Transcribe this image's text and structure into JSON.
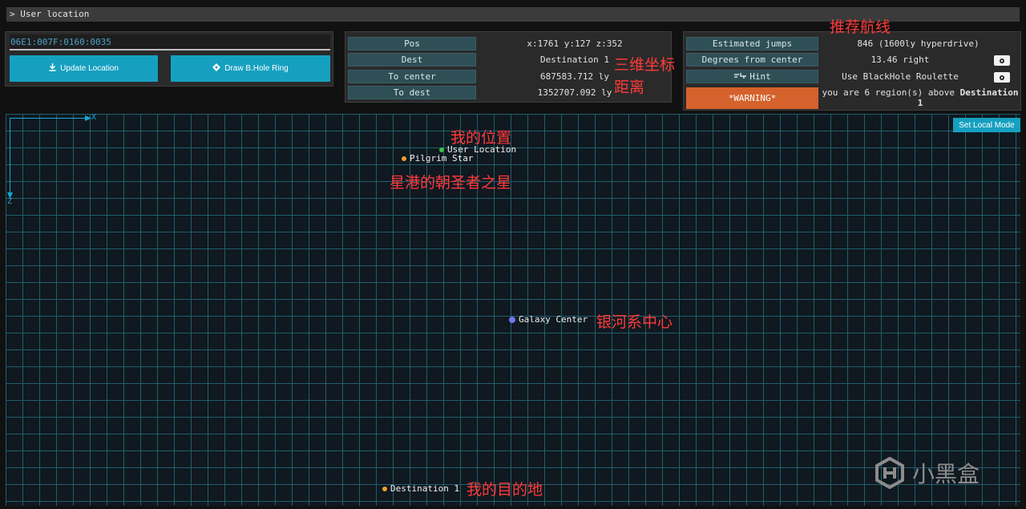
{
  "header": {
    "title": "> User location"
  },
  "location": {
    "coord_value": "06E1:007F:0160:0035",
    "update_button": "Update Location",
    "draw_button": "Draw B.Hole Ring"
  },
  "position_panel": {
    "rows": [
      {
        "label": "Pos",
        "value": "x:1761 y:127 z:352"
      },
      {
        "label": "Dest",
        "value": "Destination 1"
      },
      {
        "label": "To center",
        "value": "687583.712 ly"
      },
      {
        "label": "To dest",
        "value": "1352707.092 ly"
      }
    ]
  },
  "route_panel": {
    "estimated_jumps_label": "Estimated jumps",
    "estimated_jumps_value": "846 (1600ly hyperdrive)",
    "degrees_label": "Degrees from center",
    "degrees_value": "13.46 right",
    "hint_label": "Hint",
    "hint_value": "Use BlackHole Roulette",
    "warning_label": "*WARNING*",
    "warning_text_a": "you are 6 region(s) above",
    "warning_text_b": "Destination 1"
  },
  "map": {
    "axis_x": "X",
    "axis_z": "Z",
    "local_mode_button": "Set Local Mode",
    "points": {
      "user": "User Location",
      "pilgrim": "Pilgrim Star",
      "center": "Galaxy Center",
      "dest": "Destination 1"
    },
    "colors": {
      "user": "#3cc14a",
      "pilgrim": "#f0a030",
      "center": "#7b72f0",
      "dest": "#f0a030"
    }
  },
  "annotations": {
    "route": "推荐航线",
    "coords": "三维坐标",
    "distance": "距离",
    "my_position": "我的位置",
    "pilgrim_star": "星港的朝圣者之星",
    "galaxy_center": "银河系中心",
    "destination": "我的目的地"
  },
  "watermark": {
    "text": "小黑盒"
  }
}
